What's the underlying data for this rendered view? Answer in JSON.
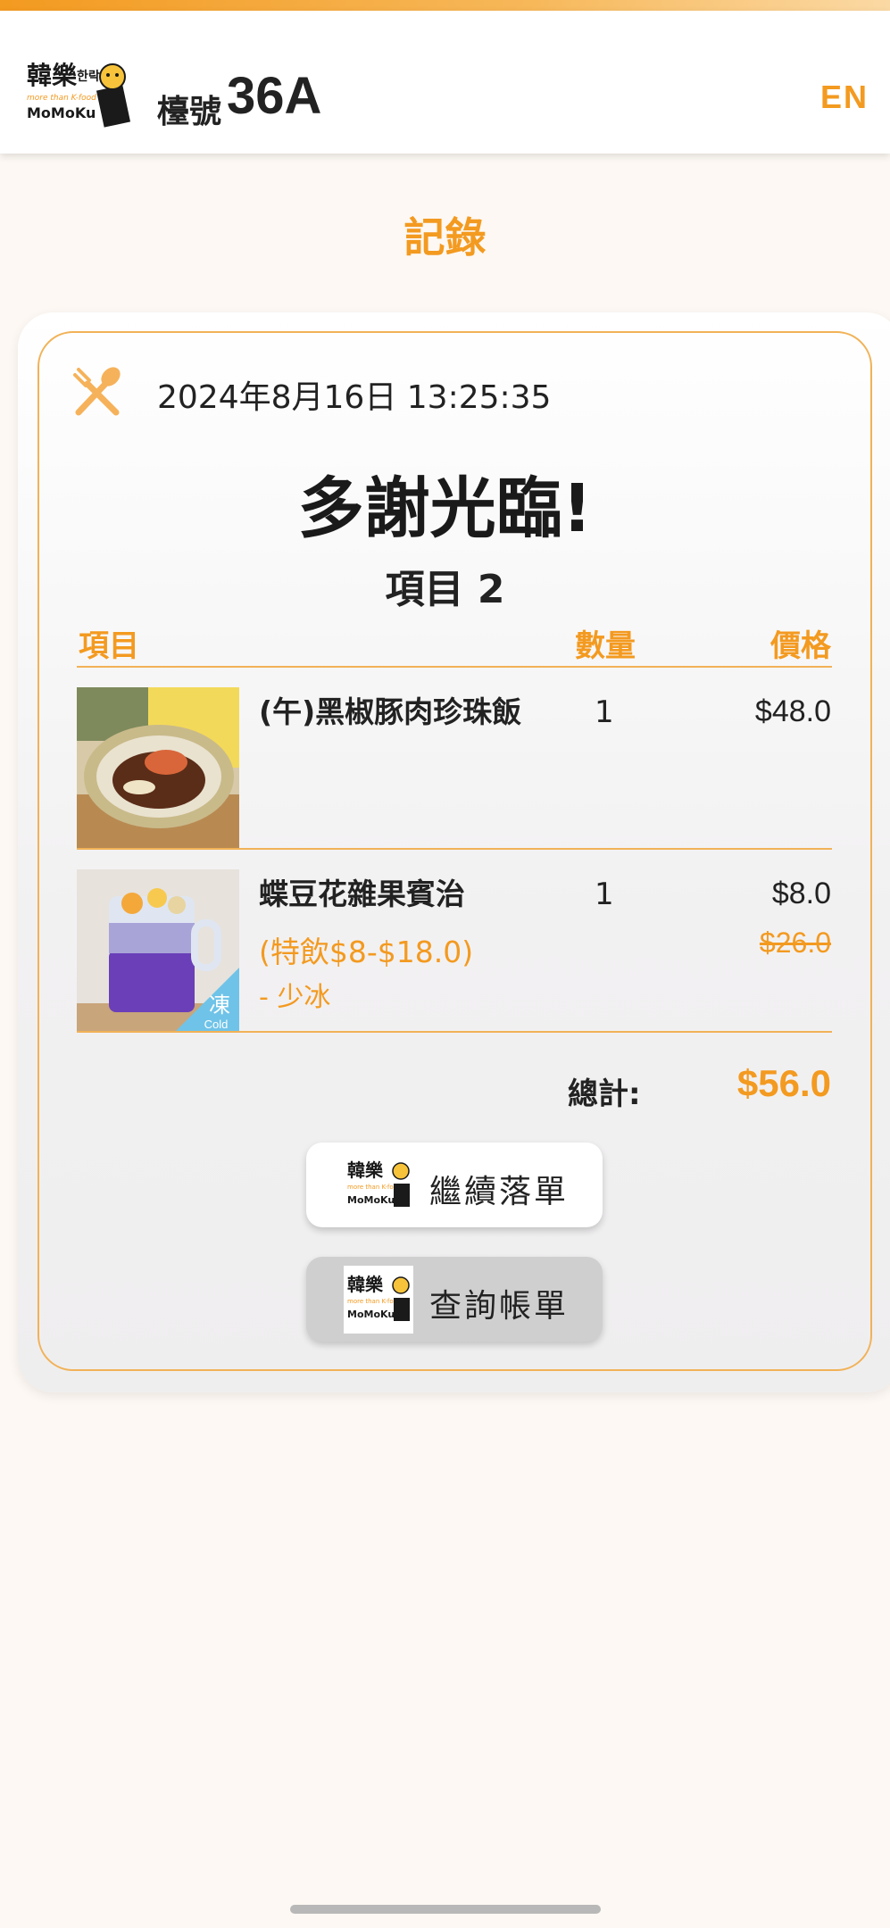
{
  "header": {
    "logo_text": "韓樂 한락 more than K-food MoMoKu",
    "table_label": "檯號",
    "table_number": "36A",
    "language_toggle": "EN"
  },
  "page_title": "記錄",
  "receipt": {
    "datetime": "2024年8月16日 13:25:35",
    "thanks": "多謝光臨!",
    "items_count": "項目 2",
    "columns": {
      "item": "項目",
      "qty": "數量",
      "price": "價格"
    },
    "items": [
      {
        "name": "(午)黑椒豚肉珍珠飯",
        "qty": "1",
        "price": "$48.0"
      },
      {
        "name": "蝶豆花雜果賓治",
        "sub": "(特飲$8-$18.0)",
        "note": "- 少冰",
        "qty": "1",
        "price": "$8.0",
        "original_price": "$26.0",
        "badge_main": "凍",
        "badge_sub": "Cold"
      }
    ],
    "total_label": "總計:",
    "total_value": "$56.0"
  },
  "buttons": {
    "continue_label": "繼續落單",
    "bill_label": "查詢帳單"
  },
  "colors": {
    "accent": "#f39a20",
    "border": "#f1b257",
    "text": "#222222"
  }
}
